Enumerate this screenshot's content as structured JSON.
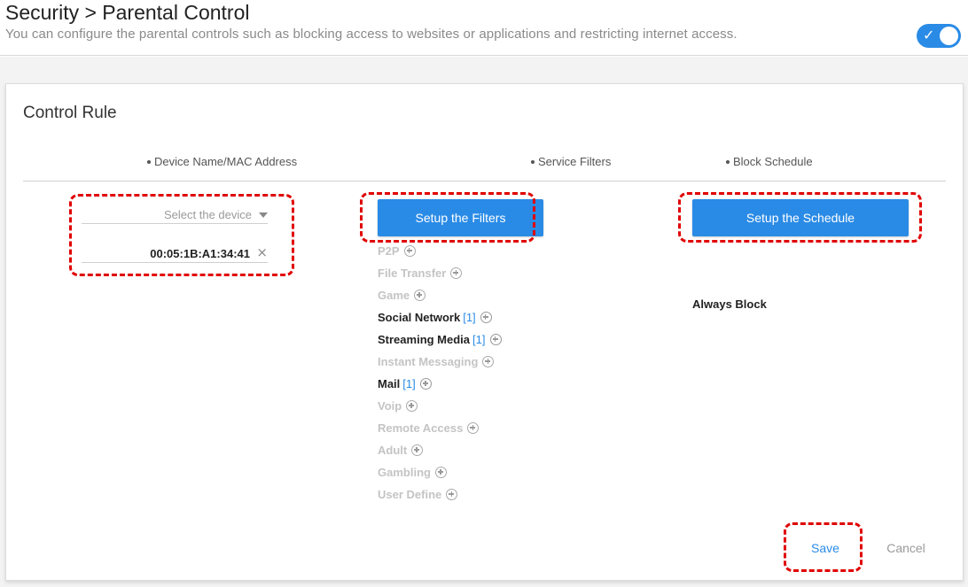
{
  "header": {
    "title": "Security > Parental Control",
    "subtitle": "You can configure the parental controls such as blocking access to websites or applications and restricting internet access.",
    "toggle_checkmark": "✓",
    "toggle_on": true
  },
  "card": {
    "title": "Control Rule",
    "columns": {
      "device": "Device Name/MAC Address",
      "filters": "Service Filters",
      "schedule": "Block Schedule"
    }
  },
  "device": {
    "select_placeholder": "Select the device",
    "mac_address": "00:05:1B:A1:34:41",
    "remove_glyph": "×"
  },
  "filters": {
    "button_label": "Setup the Filters",
    "items": [
      {
        "label": "P2P",
        "count": "",
        "active": false
      },
      {
        "label": "File Transfer",
        "count": "",
        "active": false
      },
      {
        "label": "Game",
        "count": "",
        "active": false
      },
      {
        "label": "Social Network",
        "count": "[1]",
        "active": true
      },
      {
        "label": "Streaming Media",
        "count": "[1]",
        "active": true
      },
      {
        "label": "Instant Messaging",
        "count": "",
        "active": false
      },
      {
        "label": "Mail",
        "count": "[1]",
        "active": true
      },
      {
        "label": "Voip",
        "count": "",
        "active": false
      },
      {
        "label": "Remote Access",
        "count": "",
        "active": false
      },
      {
        "label": "Adult",
        "count": "",
        "active": false
      },
      {
        "label": "Gambling",
        "count": "",
        "active": false
      },
      {
        "label": "User Define",
        "count": "",
        "active": false
      }
    ]
  },
  "schedule": {
    "button_label": "Setup the Schedule",
    "value": "Always Block"
  },
  "actions": {
    "save": "Save",
    "cancel": "Cancel"
  },
  "colors": {
    "accent": "#2a8be6",
    "annotation": "#e00000"
  }
}
